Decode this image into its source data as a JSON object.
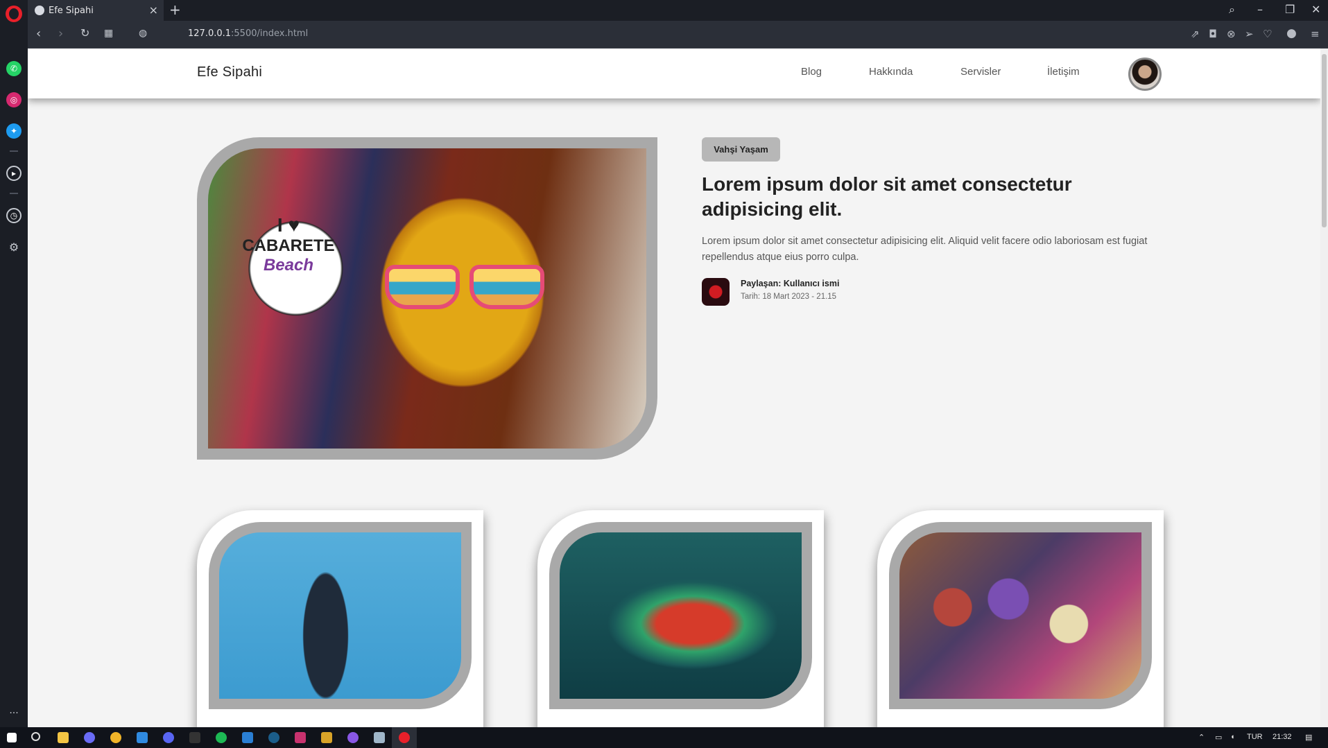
{
  "browser": {
    "tab_title": "Efe Sipahi",
    "new_tab": "+",
    "tab_close": "×",
    "url_host": "127.0.0.1",
    "url_rest": ":5500/index.html"
  },
  "site": {
    "brand": "Efe Sipahi",
    "nav": [
      "Blog",
      "Hakkında",
      "Servisler",
      "İletişim"
    ]
  },
  "featured": {
    "category": "Vahşi Yaşam",
    "title": "Lorem ipsum dolor sit amet consectetur adipisicing elit.",
    "excerpt": "Lorem ipsum dolor sit amet consectetur adipisicing elit. Aliquid velit facere odio laboriosam est fugiat repellendus atque eius porro culpa.",
    "author_label": "Paylaşan: Kullanıcı ismi",
    "date_label": "Tarih: 18 Mart 2023 - 21.15",
    "image_text": [
      "I ♥",
      "CABARETE",
      "Beach"
    ]
  },
  "cards": [
    {
      "image": "robot-hand-photo"
    },
    {
      "image": "chameleon-photo"
    },
    {
      "image": "parade-photo"
    }
  ],
  "taskbar": {
    "lang": "TUR",
    "time": "21:32"
  },
  "colors": {
    "accent_opera": "#e8202a",
    "frame_gray": "#a9a9a9",
    "badge_gray": "#b7b7b7"
  }
}
